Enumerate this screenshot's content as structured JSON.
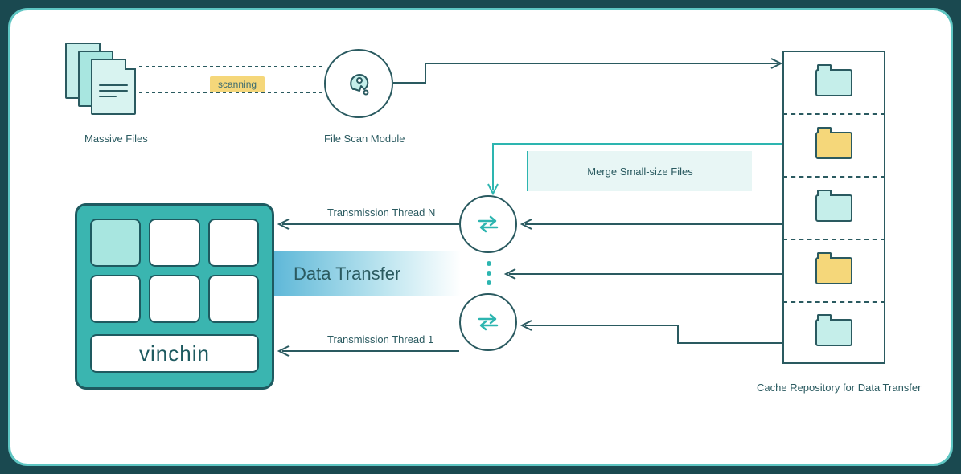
{
  "labels": {
    "massive_files": "Massive Files",
    "scanning": "scanning",
    "file_scan_module": "File Scan Module",
    "merge_small_files": "Merge Small-size Files",
    "transmission_n": "Transmission Thread N",
    "transmission_1": "Transmission Thread 1",
    "data_transfer": "Data Transfer",
    "vinchin": "vinchin",
    "cache_repo": "Cache Repository for Data Transfer"
  },
  "cache_folders": [
    {
      "color": "teal"
    },
    {
      "color": "yellow"
    },
    {
      "color": "teal"
    },
    {
      "color": "yellow"
    },
    {
      "color": "teal"
    }
  ],
  "colors": {
    "bg": "#1a4950",
    "accent": "#3ab5b0",
    "line": "#2a5a60",
    "teal_line": "#2db5b0",
    "badge": "#f5d77a"
  }
}
